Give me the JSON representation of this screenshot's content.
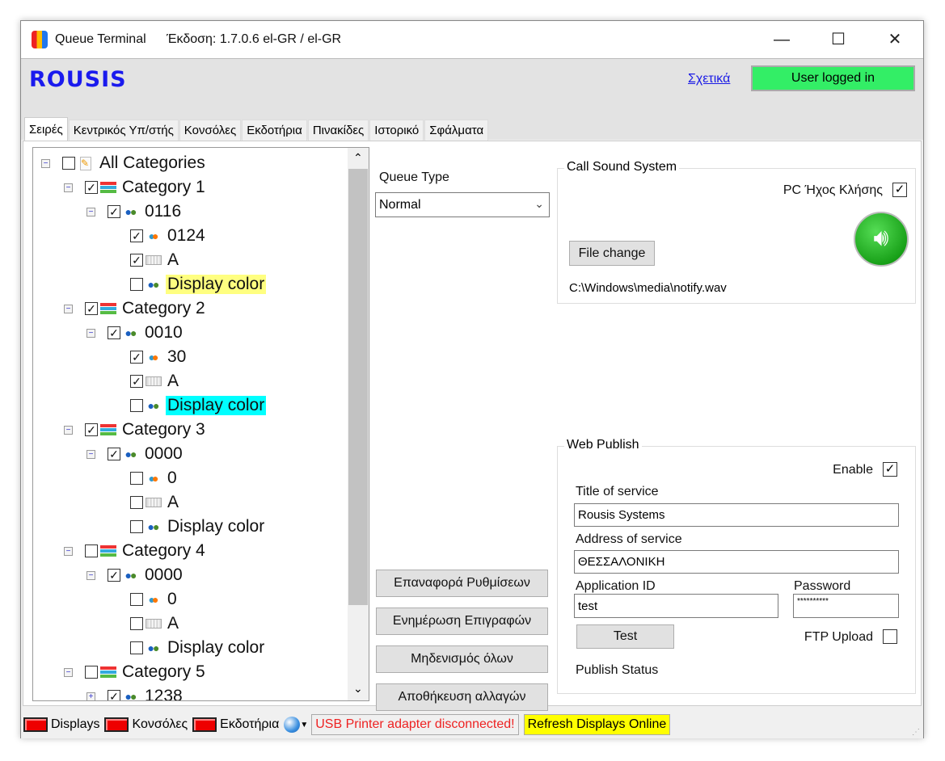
{
  "window": {
    "title": "Queue Terminal",
    "version": "Έκδοση:  1.7.0.6  el-GR  / el-GR",
    "minimize": "—",
    "maximize": "☐",
    "close": "✕"
  },
  "header": {
    "logo": "ROUSIS",
    "about_link": "Σχετικά",
    "user_status": "User logged in",
    "user_status_color": "#33ee66"
  },
  "tabs": [
    {
      "label": "Σειρές",
      "active": true
    },
    {
      "label": "Κεντρικός Υπ/στής"
    },
    {
      "label": "Κονσόλες"
    },
    {
      "label": "Εκδοτήρια"
    },
    {
      "label": "Πινακίδες"
    },
    {
      "label": "Ιστορικό"
    },
    {
      "label": "Σφάλματα"
    }
  ],
  "tree": [
    {
      "label": "All Categories",
      "level": 0,
      "checked": false,
      "icon": "note-icon",
      "expander": "minus"
    },
    {
      "label": "Category 1",
      "level": 1,
      "checked": true,
      "icon": "category-icon",
      "expander": "minus"
    },
    {
      "label": "0116",
      "level": 2,
      "checked": true,
      "icon": "people-icon",
      "expander": "minus"
    },
    {
      "label": "0124",
      "level": 3,
      "checked": true,
      "icon": "users-orange-icon"
    },
    {
      "label": "A",
      "level": 3,
      "checked": true,
      "icon": "keyboard-icon"
    },
    {
      "label": "Display color",
      "level": 3,
      "checked": false,
      "icon": "people-icon",
      "highlight": "#ffff80"
    },
    {
      "label": "Category 2",
      "level": 1,
      "checked": true,
      "icon": "category-icon",
      "expander": "minus"
    },
    {
      "label": "0010",
      "level": 2,
      "checked": true,
      "icon": "people-icon",
      "expander": "minus"
    },
    {
      "label": "30",
      "level": 3,
      "checked": true,
      "icon": "users-orange-icon"
    },
    {
      "label": "A",
      "level": 3,
      "checked": true,
      "icon": "keyboard-icon"
    },
    {
      "label": "Display color",
      "level": 3,
      "checked": false,
      "icon": "people-icon",
      "highlight": "#00ffff"
    },
    {
      "label": "Category 3",
      "level": 1,
      "checked": true,
      "icon": "category-icon",
      "expander": "minus"
    },
    {
      "label": "0000",
      "level": 2,
      "checked": true,
      "icon": "people-icon",
      "expander": "minus"
    },
    {
      "label": "0",
      "level": 3,
      "checked": false,
      "icon": "users-orange-icon"
    },
    {
      "label": "A",
      "level": 3,
      "checked": false,
      "icon": "keyboard-icon"
    },
    {
      "label": "Display color",
      "level": 3,
      "checked": false,
      "icon": "people-icon"
    },
    {
      "label": "Category 4",
      "level": 1,
      "checked": false,
      "icon": "category-icon",
      "expander": "minus"
    },
    {
      "label": "0000",
      "level": 2,
      "checked": true,
      "icon": "people-icon",
      "expander": "minus"
    },
    {
      "label": "0",
      "level": 3,
      "checked": false,
      "icon": "users-orange-icon"
    },
    {
      "label": "A",
      "level": 3,
      "checked": false,
      "icon": "keyboard-icon"
    },
    {
      "label": "Display color",
      "level": 3,
      "checked": false,
      "icon": "people-icon"
    },
    {
      "label": "Category 5",
      "level": 1,
      "checked": false,
      "icon": "category-icon",
      "expander": "minus"
    },
    {
      "label": "1238",
      "level": 2,
      "checked": true,
      "icon": "people-icon",
      "expander": "plus"
    }
  ],
  "queue": {
    "type_label": "Queue Type",
    "type_value": "Normal"
  },
  "actions": {
    "reset": "Επαναφορά Ρυθμίσεων",
    "update": "Ενημέρωση Επιγραφών",
    "zero_all": "Μηδενισμός όλων",
    "save": "Αποθήκευση αλλαγών"
  },
  "sound": {
    "group_title": "Call Sound System",
    "pc_sound_label": "PC Ήχος Κλήσης",
    "pc_sound_checked": true,
    "file_change": "File change",
    "file_path": "C:\\Windows\\media\\notify.wav"
  },
  "web": {
    "group_title": "Web Publish",
    "enable_label": "Enable",
    "enable_checked": true,
    "title_label": "Title of service",
    "title_value": "Rousis Systems",
    "address_label": "Address of service",
    "address_value": "ΘΕΣΣΑΛΟΝΙΚΗ",
    "appid_label": "Application ID",
    "appid_value": "test",
    "password_label": "Password",
    "password_value": "**********",
    "test_button": "Test",
    "ftp_label": "FTP Upload",
    "ftp_checked": false,
    "publish_status": "Publish Status"
  },
  "statusbar": {
    "displays": "Displays",
    "consoles": "Κονσόλες",
    "dispensers": "Εκδοτήρια",
    "printer_msg": "USB Printer adapter disconnected!",
    "refresh": "Refresh Displays Online"
  }
}
